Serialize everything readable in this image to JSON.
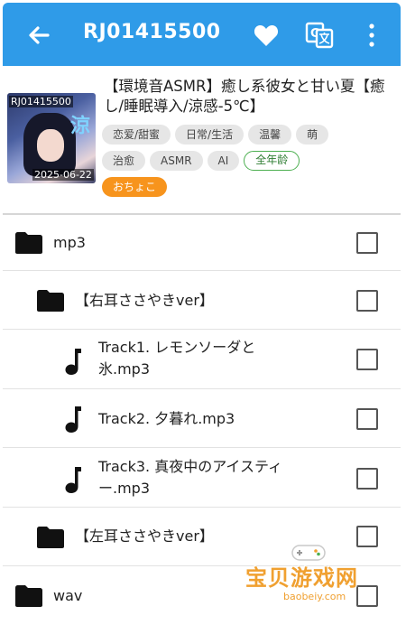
{
  "appbar": {
    "title": "RJ01415500",
    "background": "#2f9be8",
    "icons": [
      "arrow-back-icon",
      "heart-icon",
      "translate-icon",
      "more-vert-icon"
    ]
  },
  "work": {
    "title": "【環境音ASMR】癒し系彼女と甘い夏【癒し/睡眠導入/涼感-5℃】",
    "cover_code": "RJ01415500",
    "cover_date": "2025-06-22",
    "tags": [
      "恋爱/甜蜜",
      "日常/生活",
      "温馨",
      "萌",
      "治愈",
      "ASMR",
      "AI"
    ],
    "rating": "全年龄",
    "circle": "おちょこ"
  },
  "files": [
    {
      "type": "folder",
      "name": "mp3"
    },
    {
      "type": "folder",
      "name": "【右耳ささやきver】"
    },
    {
      "type": "audio",
      "name": "Track1. レモンソーダと氷.mp3"
    },
    {
      "type": "audio",
      "name": "Track2. 夕暮れ.mp3"
    },
    {
      "type": "audio",
      "name": "Track3. 真夜中のアイスティー.mp3"
    },
    {
      "type": "folder",
      "name": "【左耳ささやきver】"
    },
    {
      "type": "folder",
      "name": "wav"
    }
  ],
  "watermark": {
    "title": "宝贝游戏网",
    "url": "baobeiy.com"
  }
}
